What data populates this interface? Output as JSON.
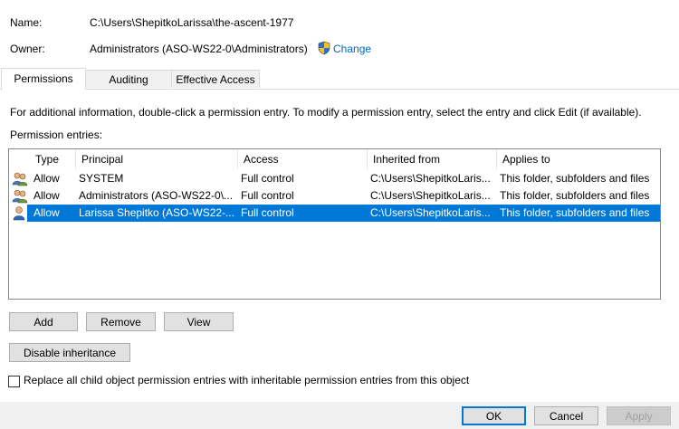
{
  "header": {
    "name_label": "Name:",
    "name_value": "C:\\Users\\ShepitkoLarissa\\the-ascent-1977",
    "owner_label": "Owner:",
    "owner_value": "Administrators (ASO-WS22-0\\Administrators)",
    "change_link": "Change"
  },
  "tabs": [
    {
      "label": "Permissions",
      "active": true
    },
    {
      "label": "Auditing",
      "active": false
    },
    {
      "label": "Effective Access",
      "active": false
    }
  ],
  "permissions": {
    "info_text": "For additional information, double-click a permission entry. To modify a permission entry, select the entry and click Edit (if available).",
    "entries_label": "Permission entries:",
    "columns": [
      "Type",
      "Principal",
      "Access",
      "Inherited from",
      "Applies to"
    ],
    "rows": [
      {
        "icon": "group-users-icon",
        "type": "Allow",
        "principal": "SYSTEM",
        "access": "Full control",
        "inherited": "C:\\Users\\ShepitkoLaris...",
        "applies": "This folder, subfolders and files",
        "selected": false
      },
      {
        "icon": "group-users-icon",
        "type": "Allow",
        "principal": "Administrators (ASO-WS22-0\\...",
        "access": "Full control",
        "inherited": "C:\\Users\\ShepitkoLaris...",
        "applies": "This folder, subfolders and files",
        "selected": false
      },
      {
        "icon": "single-user-icon",
        "type": "Allow",
        "principal": "Larissa Shepitko (ASO-WS22-...",
        "access": "Full control",
        "inherited": "C:\\Users\\ShepitkoLaris...",
        "applies": "This folder, subfolders and files",
        "selected": true
      }
    ],
    "buttons": {
      "add": "Add",
      "remove": "Remove",
      "view": "View"
    },
    "disable_inheritance": "Disable inheritance",
    "replace_checkbox": {
      "label": "Replace all child object permission entries with inheritable permission entries from this object",
      "checked": false
    }
  },
  "footer": {
    "ok": "OK",
    "cancel": "Cancel",
    "apply": "Apply"
  },
  "colors": {
    "link": "#0066cc",
    "selection": "#0078d7"
  }
}
